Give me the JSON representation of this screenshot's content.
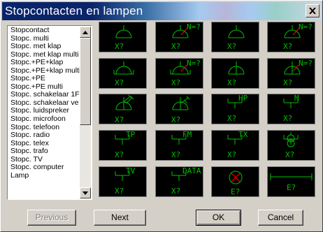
{
  "window": {
    "title": "Stopcontacten en lampen"
  },
  "list": {
    "items": [
      "Stopcontact",
      "Stopc. multi",
      "Stopc. met klap",
      "Stopc. met klap multi",
      "Stopc.+PE+klap",
      "Stopc.+PE+klap multi",
      "Stopc.+PE",
      "Stopc.+PE multi",
      "Stopc. schakelaar 1F",
      "Stopc. schakelaar ve",
      "Stopc. luidspreker",
      "Stopc. microfoon",
      "Stopc. telefoon",
      "Stopc. radio",
      "Stopc. telex",
      "Stopc. trafo",
      "Stopc. TV",
      "Stopc. computer",
      "Lamp"
    ]
  },
  "symbol_color": "#00c000",
  "accent_red": "#ff0000",
  "symbols": [
    {
      "kind": "outlet",
      "texts": [
        "X?"
      ]
    },
    {
      "kind": "outlet-n",
      "texts": [
        "N=?",
        "X?"
      ]
    },
    {
      "kind": "outlet",
      "texts": [
        "X?"
      ]
    },
    {
      "kind": "outlet-n",
      "texts": [
        "N=?",
        "X?"
      ]
    },
    {
      "kind": "outlet-klap",
      "texts": [
        "X?"
      ]
    },
    {
      "kind": "outlet-klap-n",
      "texts": [
        "N=?",
        "X?"
      ]
    },
    {
      "kind": "outlet-pe",
      "texts": [
        "X?"
      ]
    },
    {
      "kind": "outlet-pe-n",
      "texts": [
        "N=?",
        "X?"
      ]
    },
    {
      "kind": "switch",
      "texts": [
        "X?"
      ]
    },
    {
      "kind": "switch2",
      "texts": [
        "X?"
      ]
    },
    {
      "kind": "labeled",
      "texts": [
        "HP",
        "X?"
      ]
    },
    {
      "kind": "labeled",
      "texts": [
        "M",
        "X?"
      ]
    },
    {
      "kind": "labeled",
      "texts": [
        "TP",
        "X?"
      ]
    },
    {
      "kind": "labeled",
      "texts": [
        "FM",
        "X?"
      ]
    },
    {
      "kind": "labeled",
      "texts": [
        "TX",
        "X?"
      ]
    },
    {
      "kind": "trafo",
      "texts": [
        "X?"
      ]
    },
    {
      "kind": "labeled",
      "texts": [
        "TV",
        "X?"
      ]
    },
    {
      "kind": "labeled",
      "texts": [
        "DATA",
        "X?"
      ]
    },
    {
      "kind": "lamp",
      "texts": [
        "E?"
      ]
    },
    {
      "kind": "tube",
      "texts": [
        "E?"
      ]
    }
  ],
  "buttons": {
    "previous": "Previous",
    "next": "Next",
    "ok": "OK",
    "cancel": "Cancel"
  }
}
